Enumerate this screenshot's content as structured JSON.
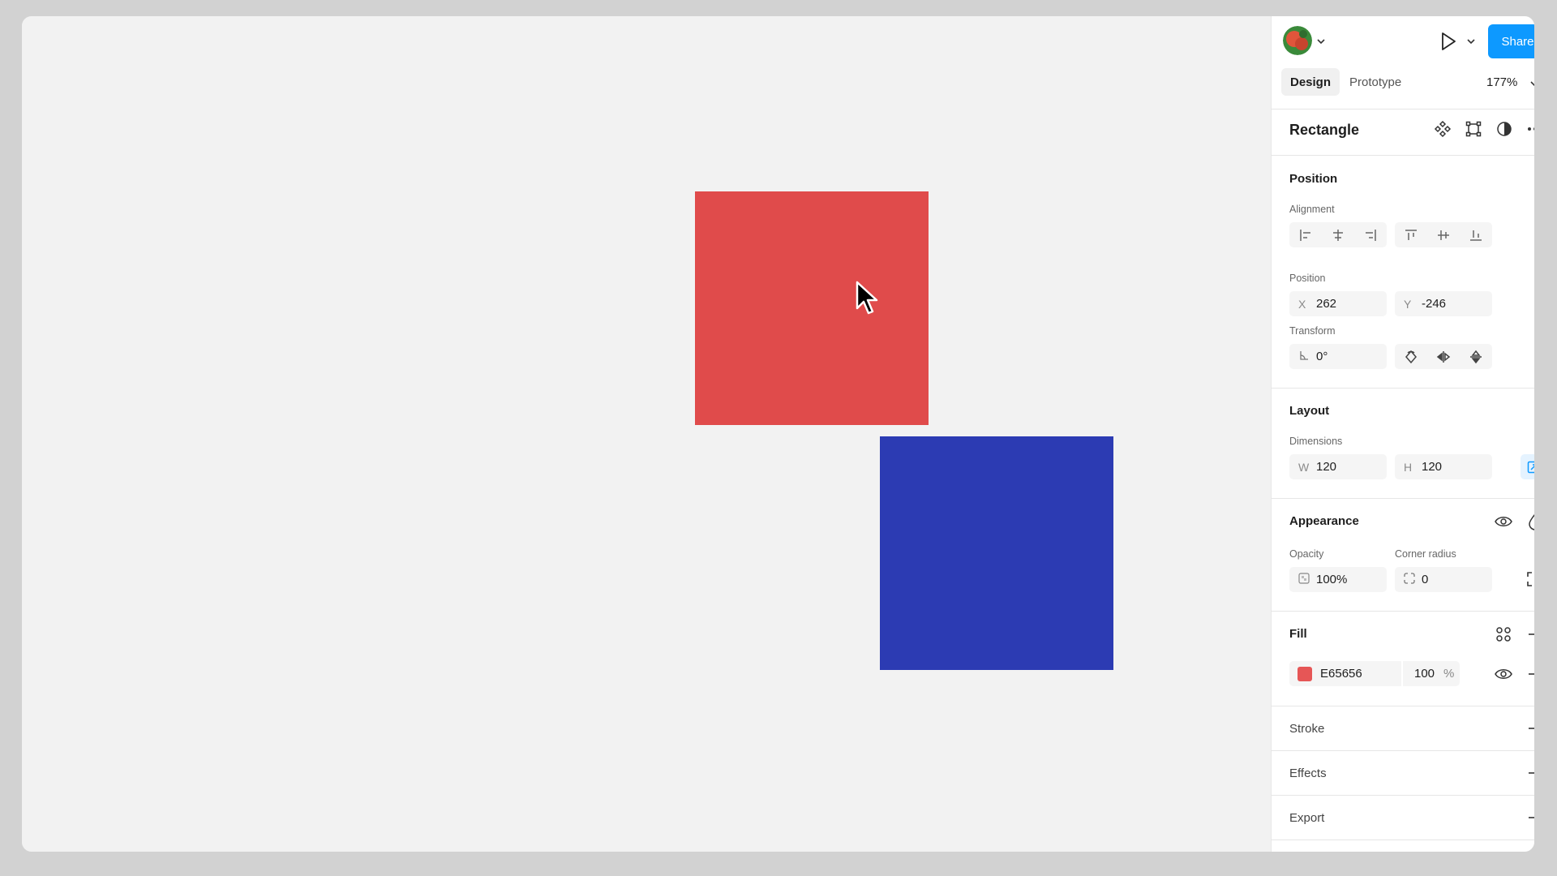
{
  "canvas": {
    "shapes": [
      {
        "name": "red-rectangle",
        "color": "#E04B4B"
      },
      {
        "name": "blue-rectangle",
        "color": "#2C3BB3"
      }
    ]
  },
  "header": {
    "share_label": "Share",
    "zoom": "177%",
    "tabs": [
      {
        "label": "Design",
        "active": true
      },
      {
        "label": "Prototype",
        "active": false
      }
    ]
  },
  "layer": {
    "title": "Rectangle"
  },
  "position_section": {
    "title": "Position",
    "alignment_label": "Alignment",
    "position_label": "Position",
    "x_prefix": "X",
    "x_value": "262",
    "y_prefix": "Y",
    "y_value": "-246",
    "transform_label": "Transform",
    "rotation_value": "0°"
  },
  "layout_section": {
    "title": "Layout",
    "dimensions_label": "Dimensions",
    "w_prefix": "W",
    "w_value": "120",
    "h_prefix": "H",
    "h_value": "120"
  },
  "appearance_section": {
    "title": "Appearance",
    "opacity_label": "Opacity",
    "opacity_value": "100%",
    "corner_radius_label": "Corner radius",
    "corner_radius_value": "0"
  },
  "fill_section": {
    "title": "Fill",
    "hex": "E65656",
    "swatch_color": "#E65656",
    "opacity": "100",
    "percent_sign": "%"
  },
  "stroke_section": {
    "title": "Stroke"
  },
  "effects_section": {
    "title": "Effects"
  },
  "export_section": {
    "title": "Export"
  },
  "colors": {
    "accent": "#0d99ff"
  }
}
